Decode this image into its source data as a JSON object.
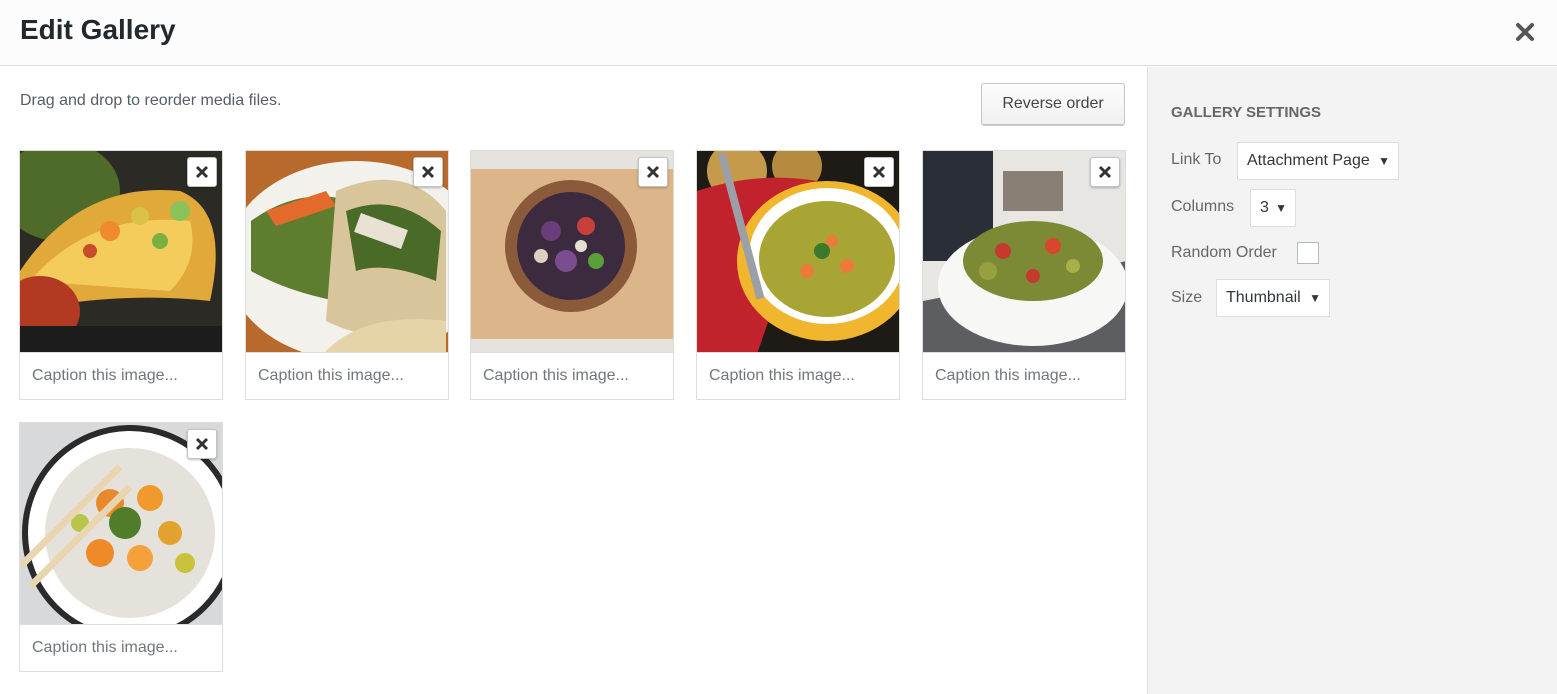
{
  "header": {
    "title": "Edit Gallery",
    "close_icon": "close-icon"
  },
  "main": {
    "instructions": "Drag and drop to reorder media files.",
    "reverse_label": "Reverse order",
    "caption_placeholder": "Caption this image...",
    "images": [
      {
        "subject": "tacos"
      },
      {
        "subject": "veggie wrap"
      },
      {
        "subject": "salad bowl"
      },
      {
        "subject": "soup"
      },
      {
        "subject": "pasta salad"
      },
      {
        "subject": "roasted vegetables"
      }
    ]
  },
  "sidebar": {
    "title": "Gallery Settings",
    "link_to": {
      "label": "Link To",
      "value": "Attachment Page"
    },
    "columns": {
      "label": "Columns",
      "value": "3"
    },
    "random_order": {
      "label": "Random Order",
      "checked": false
    },
    "size": {
      "label": "Size",
      "value": "Thumbnail"
    }
  }
}
